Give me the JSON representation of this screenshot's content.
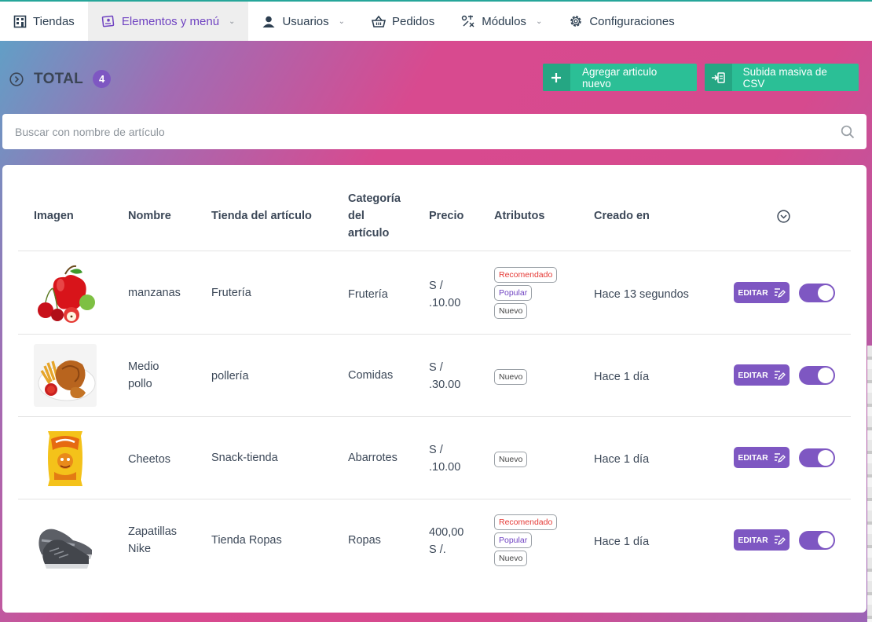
{
  "nav": {
    "items": [
      {
        "label": "Tiendas",
        "icon": "store-icon",
        "active": false,
        "dropdown": false
      },
      {
        "label": "Elementos y menú",
        "icon": "menu-items-icon",
        "active": true,
        "dropdown": true
      },
      {
        "label": "Usuarios",
        "icon": "user-icon",
        "active": false,
        "dropdown": true
      },
      {
        "label": "Pedidos",
        "icon": "basket-icon",
        "active": false,
        "dropdown": false
      },
      {
        "label": "Módulos",
        "icon": "modules-icon",
        "active": false,
        "dropdown": true
      },
      {
        "label": "Configuraciones",
        "icon": "gear-icon",
        "active": false,
        "dropdown": false
      }
    ]
  },
  "header": {
    "total_label": "TOTAL",
    "total_count": "4",
    "add_label": "Agregar articulo nuevo",
    "csv_label": "Subida masiva de CSV"
  },
  "search": {
    "placeholder": "Buscar con nombre de artículo"
  },
  "table": {
    "headers": {
      "image": "Imagen",
      "name": "Nombre",
      "store": "Tienda del artículo",
      "category": "Categoría del artículo",
      "price": "Precio",
      "attributes": "Atributos",
      "created": "Creado en"
    },
    "edit_label": "EDITAR",
    "rows": [
      {
        "name": "manzanas",
        "store": "Frutería",
        "category": "Frutería",
        "price": "S / .10.00",
        "tags": [
          "Recomendado",
          "Popular",
          "Nuevo"
        ],
        "created": "Hace 13 segundos",
        "image": "apple-image",
        "enabled": true
      },
      {
        "name": "Medio pollo",
        "store": "pollería",
        "category": "Comidas",
        "price": "S / .30.00",
        "tags": [
          "Nuevo"
        ],
        "created": "Hace 1 día",
        "image": "chicken-image",
        "enabled": true
      },
      {
        "name": "Cheetos",
        "store": "Snack-tienda",
        "category": "Abarrotes",
        "price": "S / .10.00",
        "tags": [
          "Nuevo"
        ],
        "created": "Hace 1 día",
        "image": "snack-bag-image",
        "enabled": true
      },
      {
        "name": "Zapatillas Nike",
        "store": "Tienda Ropas",
        "category": "Ropas",
        "price": "400,00 S /.",
        "tags": [
          "Recomendado",
          "Popular",
          "Nuevo"
        ],
        "created": "Hace 1 día",
        "image": "sneaker-image",
        "enabled": true
      }
    ]
  }
}
